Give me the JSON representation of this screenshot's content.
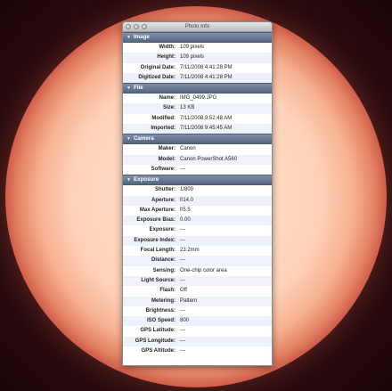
{
  "window": {
    "title": "Photo Info"
  },
  "sections": {
    "image": {
      "title": "Image",
      "rows": [
        {
          "label": "Width:",
          "value": "109 pixels"
        },
        {
          "label": "Height:",
          "value": "109 pixels"
        },
        {
          "label": "Original Date:",
          "value": "7/11/2008 4:41:28 PM"
        },
        {
          "label": "Digitized Date:",
          "value": "7/11/2008 4:41:28 PM"
        }
      ]
    },
    "file": {
      "title": "File",
      "rows": [
        {
          "label": "Name:",
          "value": "IMG_0499.JPG"
        },
        {
          "label": "Size:",
          "value": "13 KB"
        },
        {
          "label": "Modified:",
          "value": "7/11/2008 9:52:48 AM"
        },
        {
          "label": "Imported:",
          "value": "7/11/2008 9:45:45 AM"
        }
      ]
    },
    "camera": {
      "title": "Camera",
      "rows": [
        {
          "label": "Maker:",
          "value": "Canon"
        },
        {
          "label": "Model:",
          "value": "Canon PowerShot A560"
        },
        {
          "label": "Software:",
          "value": "---"
        }
      ]
    },
    "exposure": {
      "title": "Exposure",
      "rows": [
        {
          "label": "Shutter:",
          "value": "1/800"
        },
        {
          "label": "Aperture:",
          "value": "f/14.0"
        },
        {
          "label": "Max Aperture:",
          "value": "f/5.5"
        },
        {
          "label": "Exposure Bias:",
          "value": "0.00"
        },
        {
          "label": "Exposure:",
          "value": "---"
        },
        {
          "label": "Exposure Index:",
          "value": "---"
        },
        {
          "label": "Focal Length:",
          "value": "23.2mm"
        },
        {
          "label": "Distance:",
          "value": "---"
        },
        {
          "label": "Sensing:",
          "value": "One-chip color area"
        },
        {
          "label": "Light Source:",
          "value": "---"
        },
        {
          "label": "Flash:",
          "value": "Off"
        },
        {
          "label": "Metering:",
          "value": "Pattern"
        },
        {
          "label": "Brightness:",
          "value": "---"
        },
        {
          "label": "ISO Speed:",
          "value": "800"
        },
        {
          "label": "GPS Latitude:",
          "value": "---"
        },
        {
          "label": "GPS Longitude:",
          "value": "---"
        },
        {
          "label": "GPS Altitude:",
          "value": "---"
        }
      ]
    }
  }
}
